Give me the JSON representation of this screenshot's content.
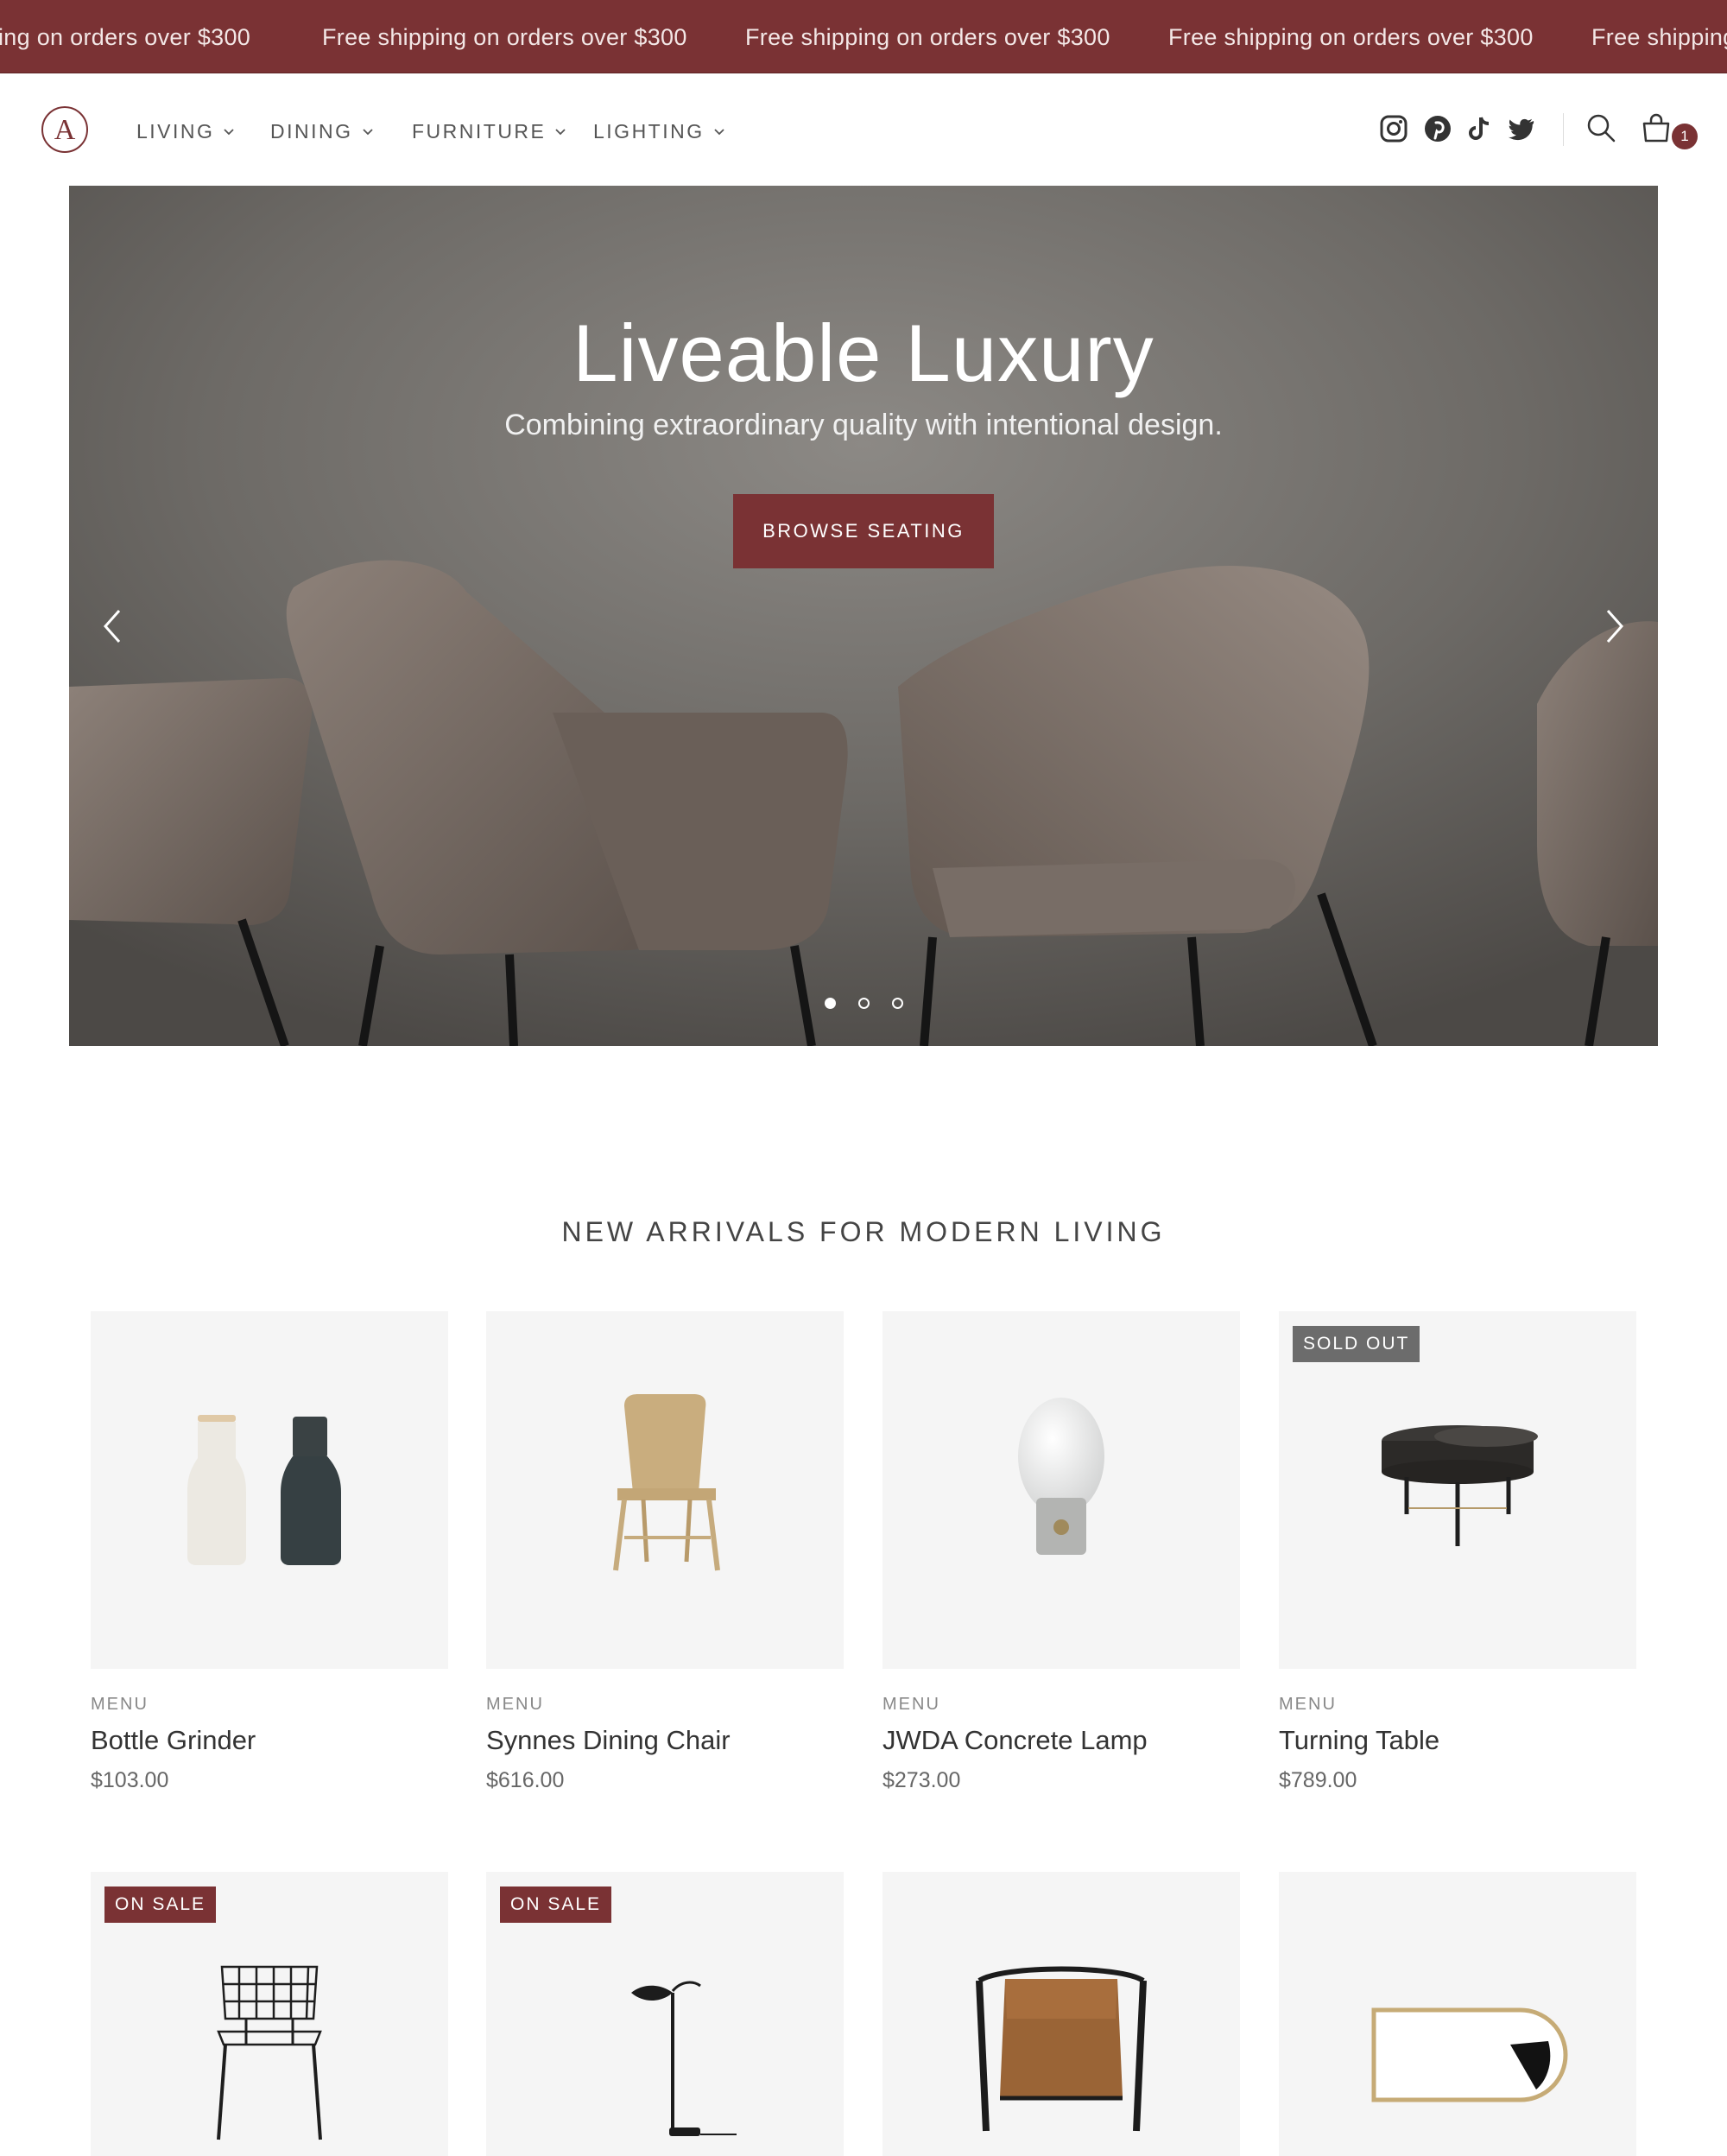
{
  "announcement": {
    "messages": [
      "ing on orders over $300",
      "Free shipping on orders over $300",
      "Free shipping on orders over $300",
      "Free shipping on orders over $300",
      "Free shipping"
    ]
  },
  "header": {
    "logo_letter": "A",
    "nav": [
      {
        "label": "LIVING"
      },
      {
        "label": "DINING"
      },
      {
        "label": "FURNITURE"
      },
      {
        "label": "LIGHTING"
      }
    ],
    "social_icons": [
      "instagram-icon",
      "pinterest-icon",
      "tiktok-icon",
      "twitter-icon"
    ],
    "cart_count": "1"
  },
  "hero": {
    "title": "Liveable Luxury",
    "subtitle": "Combining extraordinary quality with intentional design.",
    "button_label": "BROWSE SEATING",
    "slides": 3,
    "active_slide": 1
  },
  "section": {
    "title": "NEW ARRIVALS FOR MODERN LIVING"
  },
  "products": [
    {
      "vendor": "MENU",
      "name": "Bottle Grinder",
      "price": "$103.00",
      "badge": ""
    },
    {
      "vendor": "MENU",
      "name": "Synnes Dining Chair",
      "price": "$616.00",
      "badge": ""
    },
    {
      "vendor": "MENU",
      "name": "JWDA Concrete Lamp",
      "price": "$273.00",
      "badge": ""
    },
    {
      "vendor": "MENU",
      "name": "Turning Table",
      "price": "$789.00",
      "badge": "SOLD OUT"
    },
    {
      "vendor": "",
      "name": "",
      "price": "",
      "badge": "ON SALE"
    },
    {
      "vendor": "",
      "name": "",
      "price": "",
      "badge": "ON SALE"
    },
    {
      "vendor": "",
      "name": "",
      "price": "",
      "badge": ""
    },
    {
      "vendor": "",
      "name": "",
      "price": "",
      "badge": ""
    }
  ],
  "colors": {
    "brand": "#7a3234",
    "sold_out_badge": "#6c6c6c",
    "card_background": "#f5f5f5"
  }
}
